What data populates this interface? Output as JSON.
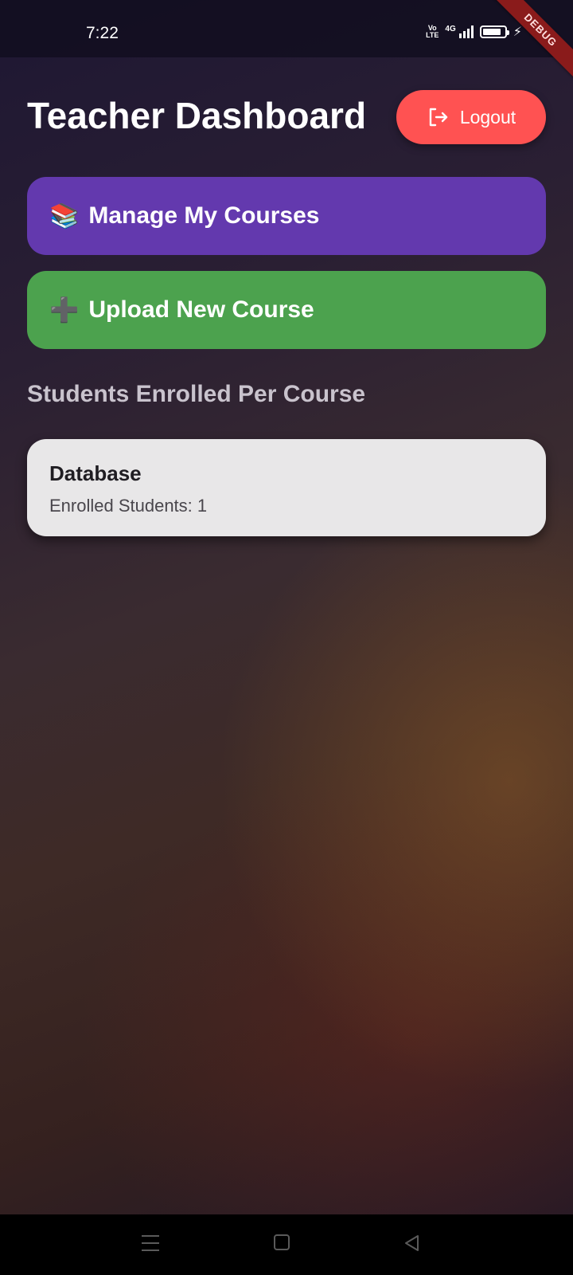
{
  "status_bar": {
    "time": "7:22",
    "volte_label": "Vo\nLTE",
    "network_label": "4G"
  },
  "debug_banner": "DEBUG",
  "header": {
    "title": "Teacher Dashboard",
    "logout_label": "Logout"
  },
  "actions": {
    "manage": {
      "emoji": "📚",
      "label": "Manage My Courses"
    },
    "upload": {
      "emoji": "➕",
      "label": "Upload New Course"
    }
  },
  "section_title": "Students Enrolled Per Course",
  "courses": [
    {
      "name": "Database",
      "enrolled_text": "Enrolled Students: 1"
    }
  ],
  "colors": {
    "logout": "#ff5252",
    "manage": "#6339ae",
    "upload": "#4ca24e",
    "card": "#e8e7e8"
  },
  "icons": {
    "logout": "logout-icon",
    "menu": "menu-icon",
    "home": "home-icon",
    "back": "back-icon"
  }
}
